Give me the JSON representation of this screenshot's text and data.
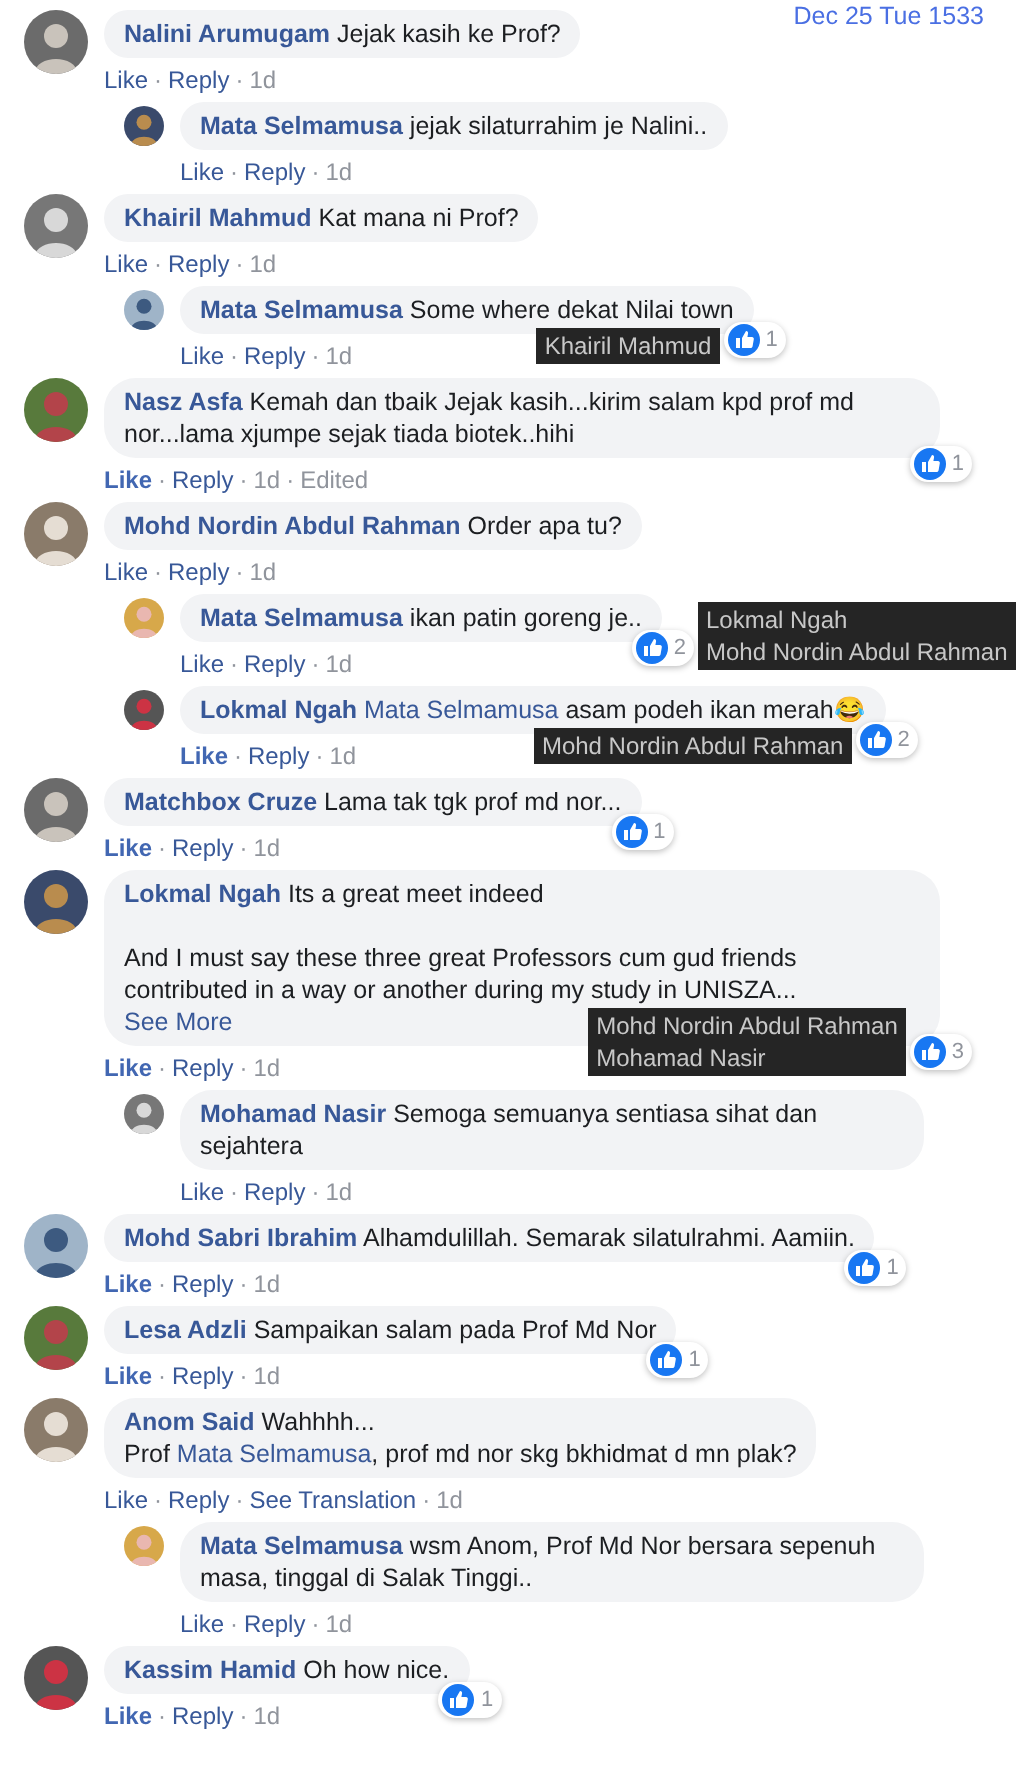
{
  "timestamp": "Dec 25 Tue 1533",
  "separator": "·",
  "comments": [
    {
      "author": "Nalini Arumugam",
      "body": [
        {
          "kind": "text",
          "text": "Jejak kasih ke Prof?"
        }
      ],
      "liked": false,
      "actions": [
        {
          "kind": "like",
          "text": "Like"
        },
        {
          "kind": "reply",
          "text": "Reply"
        },
        {
          "kind": "time",
          "text": "1d"
        }
      ],
      "replies": [
        {
          "author": "Mata Selmamusa",
          "body": [
            {
              "kind": "text",
              "text": "jejak silaturrahim je Nalini.."
            }
          ],
          "liked": false,
          "actions": [
            {
              "kind": "like",
              "text": "Like"
            },
            {
              "kind": "reply",
              "text": "Reply"
            },
            {
              "kind": "time",
              "text": "1d"
            }
          ]
        }
      ]
    },
    {
      "author": "Khairil Mahmud",
      "body": [
        {
          "kind": "text",
          "text": "Kat mana ni Prof?"
        }
      ],
      "liked": false,
      "actions": [
        {
          "kind": "like",
          "text": "Like"
        },
        {
          "kind": "reply",
          "text": "Reply"
        },
        {
          "kind": "time",
          "text": "1d"
        }
      ],
      "replies": [
        {
          "author": "Mata Selmamusa",
          "body": [
            {
              "kind": "text",
              "text": "Some where dekat Nilai town"
            }
          ],
          "liked": false,
          "actions": [
            {
              "kind": "like",
              "text": "Like"
            },
            {
              "kind": "reply",
              "text": "Reply"
            },
            {
              "kind": "time",
              "text": "1d"
            }
          ],
          "reactions": {
            "count": "1",
            "names": [
              "Khairil Mahmud"
            ]
          }
        }
      ]
    },
    {
      "author": "Nasz Asfa",
      "body": [
        {
          "kind": "text",
          "text": "Kemah dan tbaik Jejak kasih...kirim salam kpd prof md nor...lama xjumpe sejak tiada biotek..hihi"
        }
      ],
      "liked": true,
      "actions": [
        {
          "kind": "like",
          "text": "Like"
        },
        {
          "kind": "reply",
          "text": "Reply"
        },
        {
          "kind": "time",
          "text": "1d"
        },
        {
          "kind": "edited",
          "text": "Edited"
        }
      ],
      "reactions": {
        "count": "1"
      }
    },
    {
      "author": "Mohd Nordin Abdul Rahman",
      "body": [
        {
          "kind": "text",
          "text": "Order apa tu?"
        }
      ],
      "liked": false,
      "actions": [
        {
          "kind": "like",
          "text": "Like"
        },
        {
          "kind": "reply",
          "text": "Reply"
        },
        {
          "kind": "time",
          "text": "1d"
        }
      ],
      "replies": [
        {
          "author": "Mata Selmamusa",
          "body": [
            {
              "kind": "text",
              "text": "ikan patin goreng je.."
            }
          ],
          "liked": false,
          "actions": [
            {
              "kind": "like",
              "text": "Like"
            },
            {
              "kind": "reply",
              "text": "Reply"
            },
            {
              "kind": "time",
              "text": "1d"
            }
          ],
          "reactions": {
            "count": "2",
            "names": [
              "Lokmal Ngah",
              "Mohd Nordin Abdul Rahman"
            ]
          }
        },
        {
          "author": "Lokmal Ngah",
          "body": [
            {
              "kind": "mention",
              "text": "Mata Selmamusa"
            },
            {
              "kind": "text",
              "text": " asam podeh ikan merah😂"
            }
          ],
          "liked": true,
          "actions": [
            {
              "kind": "like",
              "text": "Like"
            },
            {
              "kind": "reply",
              "text": "Reply"
            },
            {
              "kind": "time",
              "text": "1d"
            }
          ],
          "reactions": {
            "count": "2",
            "names": [
              "Mohd Nordin Abdul Rahman"
            ]
          }
        }
      ]
    },
    {
      "author": "Matchbox Cruze",
      "body": [
        {
          "kind": "text",
          "text": "Lama tak tgk prof md nor..."
        }
      ],
      "liked": true,
      "actions": [
        {
          "kind": "like",
          "text": "Like"
        },
        {
          "kind": "reply",
          "text": "Reply"
        },
        {
          "kind": "time",
          "text": "1d"
        }
      ],
      "reactions": {
        "count": "1"
      }
    },
    {
      "author": "Lokmal Ngah",
      "body": [
        {
          "kind": "text",
          "text": "Its a great meet indeed\n\nAnd I must say these three great Professors cum gud friends contributed in a way or another during my study in UNISZA..."
        }
      ],
      "see_more": "See More",
      "liked": true,
      "actions": [
        {
          "kind": "like",
          "text": "Like"
        },
        {
          "kind": "reply",
          "text": "Reply"
        },
        {
          "kind": "time",
          "text": "1d"
        }
      ],
      "reactions": {
        "count": "3",
        "names": [
          "Mohd Nordin Abdul Rahman",
          "Mohamad Nasir"
        ]
      },
      "replies": [
        {
          "author": "Mohamad Nasir",
          "body": [
            {
              "kind": "text",
              "text": "Semoga semuanya sentiasa sihat dan sejahtera"
            }
          ],
          "liked": false,
          "actions": [
            {
              "kind": "like",
              "text": "Like"
            },
            {
              "kind": "reply",
              "text": "Reply"
            },
            {
              "kind": "time",
              "text": "1d"
            }
          ]
        }
      ]
    },
    {
      "author": "Mohd Sabri Ibrahim",
      "body": [
        {
          "kind": "text",
          "text": "Alhamdulillah. Semarak silatulrahmi. Aamiin."
        }
      ],
      "liked": true,
      "actions": [
        {
          "kind": "like",
          "text": "Like"
        },
        {
          "kind": "reply",
          "text": "Reply"
        },
        {
          "kind": "time",
          "text": "1d"
        }
      ],
      "reactions": {
        "count": "1"
      }
    },
    {
      "author": "Lesa Adzli",
      "body": [
        {
          "kind": "text",
          "text": "Sampaikan salam pada Prof Md Nor"
        }
      ],
      "liked": true,
      "actions": [
        {
          "kind": "like",
          "text": "Like"
        },
        {
          "kind": "reply",
          "text": "Reply"
        },
        {
          "kind": "time",
          "text": "1d"
        }
      ],
      "reactions": {
        "count": "1"
      }
    },
    {
      "author": "Anom Said",
      "body": [
        {
          "kind": "text",
          "text": "Wahhhh...\nProf "
        },
        {
          "kind": "mention",
          "text": "Mata Selmamusa"
        },
        {
          "kind": "text",
          "text": ", prof md nor skg bkhidmat d mn plak?"
        }
      ],
      "liked": false,
      "actions": [
        {
          "kind": "like",
          "text": "Like"
        },
        {
          "kind": "reply",
          "text": "Reply"
        },
        {
          "kind": "translate",
          "text": "See Translation"
        },
        {
          "kind": "time",
          "text": "1d"
        }
      ],
      "replies": [
        {
          "author": "Mata Selmamusa",
          "body": [
            {
              "kind": "text",
              "text": "wsm Anom, Prof Md Nor bersara sepenuh masa, tinggal di Salak Tinggi.."
            }
          ],
          "liked": false,
          "actions": [
            {
              "kind": "like",
              "text": "Like"
            },
            {
              "kind": "reply",
              "text": "Reply"
            },
            {
              "kind": "time",
              "text": "1d"
            }
          ]
        }
      ]
    },
    {
      "author": "Kassim Hamid",
      "body": [
        {
          "kind": "text",
          "text": "Oh how nice."
        }
      ],
      "liked": true,
      "actions": [
        {
          "kind": "like",
          "text": "Like"
        },
        {
          "kind": "reply",
          "text": "Reply"
        },
        {
          "kind": "time",
          "text": "1d"
        }
      ],
      "reactions": {
        "count": "1"
      }
    }
  ]
}
